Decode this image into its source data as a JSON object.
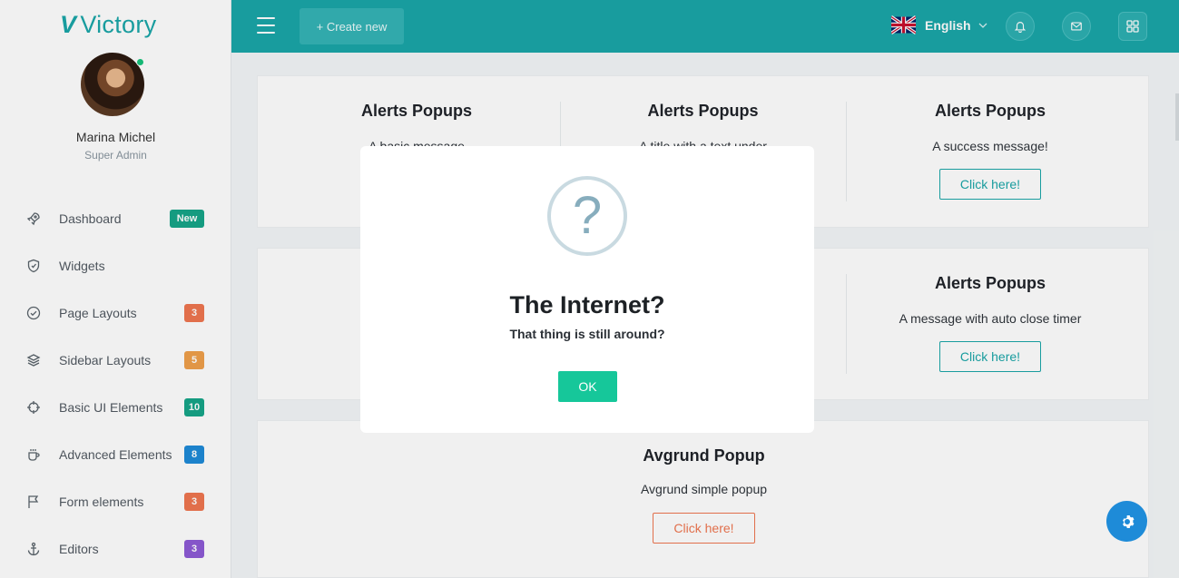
{
  "brand": {
    "mark": "V",
    "name": "Victory"
  },
  "user": {
    "name": "Marina Michel",
    "role": "Super Admin"
  },
  "menu": [
    {
      "label": "Dashboard",
      "badge": "New",
      "badge_color": "#17a589",
      "icon": "rocket-icon"
    },
    {
      "label": "Widgets",
      "badge": "",
      "badge_color": "",
      "icon": "shield-icon"
    },
    {
      "label": "Page Layouts",
      "badge": "3",
      "badge_color": "#f07650",
      "icon": "check-circle-icon"
    },
    {
      "label": "Sidebar Layouts",
      "badge": "5",
      "badge_color": "#f0a04b",
      "icon": "layers-icon"
    },
    {
      "label": "Basic UI Elements",
      "badge": "10",
      "badge_color": "#17a589",
      "icon": "crosshair-icon"
    },
    {
      "label": "Advanced Elements",
      "badge": "8",
      "badge_color": "#1e8bd8",
      "icon": "coffee-icon"
    },
    {
      "label": "Form elements",
      "badge": "3",
      "badge_color": "#f07650",
      "icon": "flag-icon"
    },
    {
      "label": "Editors",
      "badge": "3",
      "badge_color": "#8e5bd6",
      "icon": "anchor-icon"
    }
  ],
  "topbar": {
    "create_label": "+ Create new",
    "language": "English"
  },
  "cards": {
    "row1": [
      {
        "title": "Alerts Popups",
        "desc": "A basic message",
        "button": ""
      },
      {
        "title": "Alerts Popups",
        "desc": "A title with a text under",
        "button": ""
      },
      {
        "title": "Alerts Popups",
        "desc": "A success message!",
        "button": "Click here!"
      }
    ],
    "row2": [
      {
        "title": "Alerts Popups",
        "desc": "A message with auto close timer",
        "button": "Click here!"
      }
    ],
    "row3": {
      "title": "Avgrund Popup",
      "desc": "Avgrund simple popup",
      "button": "Click here!"
    }
  },
  "modal": {
    "icon": "?",
    "title": "The Internet?",
    "text": "That thing is still around?",
    "ok": "OK"
  },
  "colors": {
    "primary": "#1aa6a8",
    "success": "#16c79a",
    "accent_orange": "#f07650",
    "fab": "#1e8bd8"
  }
}
